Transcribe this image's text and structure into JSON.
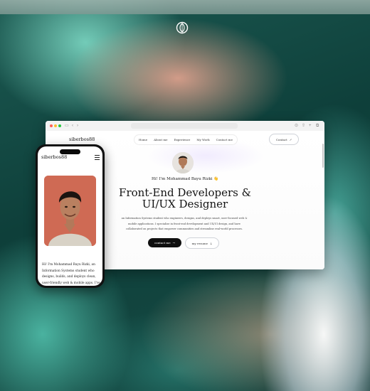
{
  "colors": {
    "accent_dark": "#0f0f0f",
    "photo_bg": "#cf6a54",
    "bg_teal": "#1c5a52"
  },
  "logo": {
    "icon": "leaf-seal-icon"
  },
  "desktop": {
    "brand": "siberbos88",
    "nav": [
      "Home",
      "About me",
      "Experience",
      "My Work",
      "Contact me"
    ],
    "contact_button": "Contact",
    "greeting": "Hi! I'm Mohammad Bayu Rizki 👋",
    "headline_line1": "Front-End Developers &",
    "headline_line2": "UI/UX Designer",
    "description": "an Information Systems student who engineers, designs, and deploys smart, user-focused web & mobile applications. I specialize in front-end development and UX/UI design, and have collaborated on projects that empower communities and streamline real-world processes.",
    "primary_button": "contact me",
    "secondary_button": "my resume"
  },
  "mobile": {
    "brand": "siberbos88",
    "intro_text": "Hi! I'm Mohammad Bayu Rizki, an Information Systems student who designs, builds, and deploys clean, user-friendly web & mobile apps. I've"
  }
}
